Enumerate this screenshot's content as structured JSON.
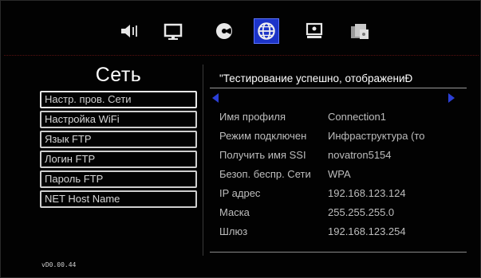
{
  "topbar": {
    "icons": [
      {
        "name": "speaker-icon"
      },
      {
        "name": "monitor-icon"
      },
      {
        "name": "disc-icon"
      },
      {
        "name": "globe-icon"
      },
      {
        "name": "hdd-icon"
      },
      {
        "name": "media-files-icon"
      }
    ],
    "selected": "globe-icon",
    "accent": "#1c34c8"
  },
  "section_title": "Сеть",
  "menu": {
    "items": [
      {
        "label": "Настр. пров. Сети"
      },
      {
        "label": "Настройка WiFi"
      },
      {
        "label": "Язык FTP"
      },
      {
        "label": "Логин FTP"
      },
      {
        "label": "Пароль FTP"
      },
      {
        "label": "NET Host Name"
      }
    ]
  },
  "status": "\"Тестирование успешно, отображениÐ",
  "details": [
    {
      "label": "Имя профиля",
      "value": "Connection1"
    },
    {
      "label": "Режим подключен",
      "value": "Инфраструктура (то"
    },
    {
      "label": "Получить имя SSI",
      "value": "novatron5154"
    },
    {
      "label": "Безоп. беспр. Сети",
      "value": "WPA"
    },
    {
      "label": "IP адрес",
      "value": "192.168.123.124"
    },
    {
      "label": "Маска",
      "value": "255.255.255.0"
    },
    {
      "label": "Шлюз",
      "value": "192.168.123.254"
    }
  ],
  "version": "vD0.00.44",
  "colors": {
    "arrow": "#2b3fd6",
    "divider": "#5a1010"
  }
}
